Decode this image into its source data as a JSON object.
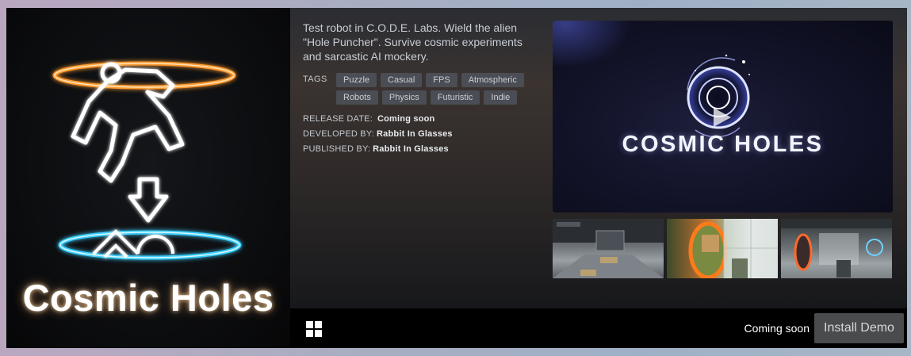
{
  "capsule": {
    "title": "Cosmic Holes"
  },
  "description": "Test robot in C.O.D.E. Labs. Wield the alien \"Hole Puncher\". Survive cosmic experiments and sarcastic AI mockery.",
  "tags_label": "TAGS",
  "tags": [
    "Puzzle",
    "Casual",
    "FPS",
    "Atmospheric",
    "Robots",
    "Physics",
    "Futuristic",
    "Indie"
  ],
  "meta": {
    "release_label": "RELEASE DATE:",
    "release_value": "Coming soon",
    "developer_label": "DEVELOPED BY:",
    "developer_value": "Rabbit In Glasses",
    "publisher_label": "PUBLISHED BY:",
    "publisher_value": "Rabbit In Glasses"
  },
  "media": {
    "title": "COSMIC HOLES",
    "play_icon": "play-icon"
  },
  "bottom": {
    "platform_icon": "windows-icon",
    "status": "Coming soon",
    "install_label": "Install Demo"
  },
  "colors": {
    "portal_orange": "#ff9a2e",
    "portal_blue": "#3ad0ff",
    "button_bg": "#4a4b4d",
    "tag_bg": "#4a4d53"
  }
}
